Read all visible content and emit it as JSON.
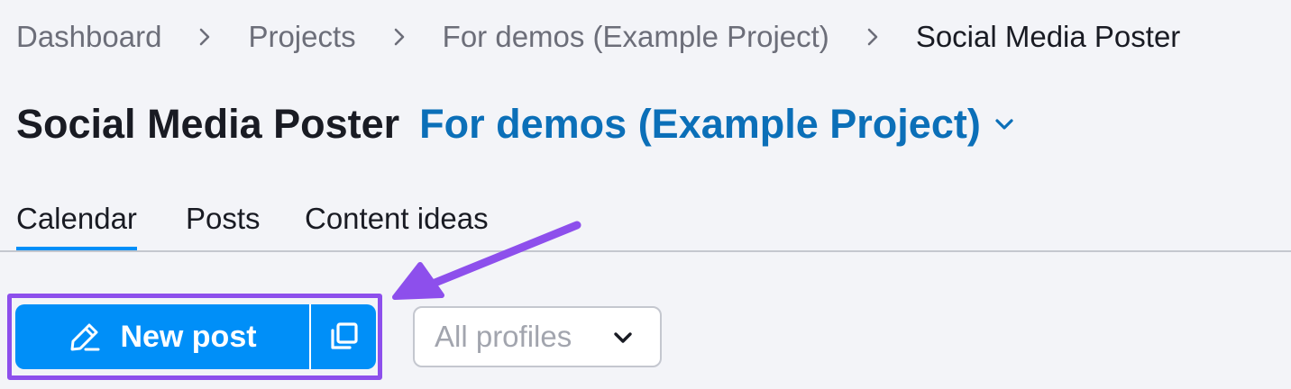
{
  "breadcrumb": {
    "items": [
      {
        "label": "Dashboard"
      },
      {
        "label": "Projects"
      },
      {
        "label": "For demos (Example Project)"
      },
      {
        "label": "Social Media Poster"
      }
    ]
  },
  "header": {
    "title": "Social Media Poster",
    "project_name": "For demos (Example Project)"
  },
  "tabs": [
    {
      "label": "Calendar",
      "active": true
    },
    {
      "label": "Posts",
      "active": false
    },
    {
      "label": "Content ideas",
      "active": false
    }
  ],
  "toolbar": {
    "new_post_label": "New post",
    "new_post_icon": "pencil-icon",
    "copy_icon": "duplicate-icon",
    "profiles_select_value": "All profiles"
  },
  "colors": {
    "accent": "#008ff8",
    "project_link": "#0b6fb8",
    "annotation": "#8d4fec",
    "background": "#f3f4f8"
  }
}
